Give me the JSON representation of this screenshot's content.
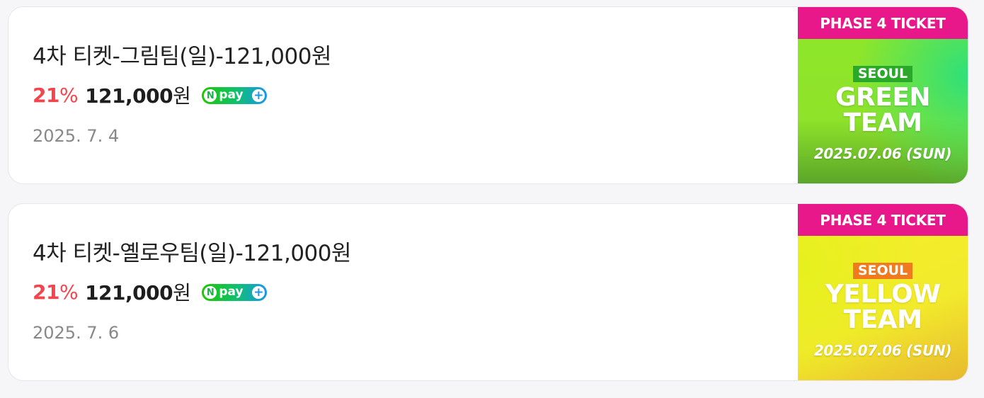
{
  "products": [
    {
      "title": "4차 티켓-그림팀(일)-121,000원",
      "discount": "21",
      "discount_unit": "%",
      "price": "121,000",
      "price_unit": "원",
      "npay_label": "pay",
      "npay_n": "N",
      "npay_plus": "+",
      "date": "2025. 7. 4",
      "thumbnail": {
        "banner": "PHASE 4 TICKET",
        "city": "SEOUL",
        "team_line1": "GREEN",
        "team_line2": "TEAM",
        "event_date": "2025.07.06 (SUN)",
        "theme_color": "#8fe32a",
        "city_badge_color": "#2aa82a"
      }
    },
    {
      "title": "4차 티켓-옐로우팀(일)-121,000원",
      "discount": "21",
      "discount_unit": "%",
      "price": "121,000",
      "price_unit": "원",
      "npay_label": "pay",
      "npay_n": "N",
      "npay_plus": "+",
      "date": "2025. 7. 6",
      "thumbnail": {
        "banner": "PHASE 4 TICKET",
        "city": "SEOUL",
        "team_line1": "YELLOW",
        "team_line2": "TEAM",
        "event_date": "2025.07.06 (SUN)",
        "theme_color": "#f2ea2c",
        "city_badge_color": "#f07a1e"
      }
    }
  ],
  "colors": {
    "discount": "#f2454d",
    "banner": "#e8178a",
    "background": "#f6f6f8"
  }
}
